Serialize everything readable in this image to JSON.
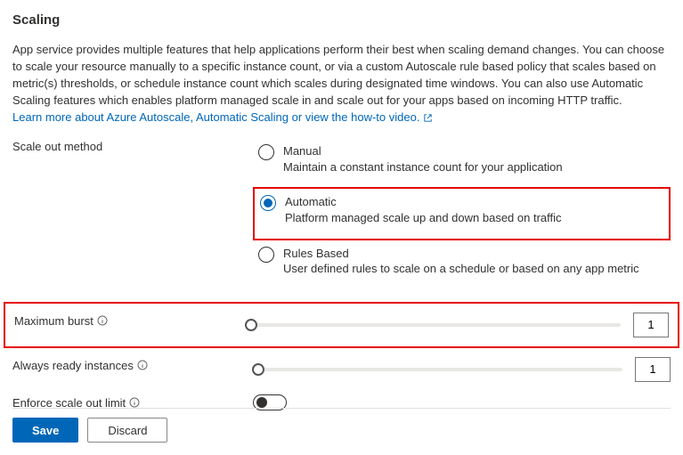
{
  "title": "Scaling",
  "description": "App service provides multiple features that help applications perform their best when scaling demand changes. You can choose to scale your resource manually to a specific instance count, or via a custom Autoscale rule based policy that scales based on metric(s) thresholds, or schedule instance count which scales during designated time windows. You can also use Automatic Scaling features which enables platform managed scale in and scale out for your apps based on incoming HTTP traffic.",
  "learn_more_link": "Learn more about Azure Autoscale, Automatic Scaling or view the how-to video.",
  "labels": {
    "scale_out_method": "Scale out method",
    "maximum_burst": "Maximum burst",
    "always_ready": "Always ready instances",
    "enforce_limit": "Enforce scale out limit"
  },
  "options": {
    "manual": {
      "title": "Manual",
      "desc": "Maintain a constant instance count for your application"
    },
    "automatic": {
      "title": "Automatic",
      "desc": "Platform managed scale up and down based on traffic"
    },
    "rules": {
      "title": "Rules Based",
      "desc": "User defined rules to scale on a schedule or based on any app metric"
    }
  },
  "values": {
    "maximum_burst": "1",
    "always_ready": "1"
  },
  "buttons": {
    "save": "Save",
    "discard": "Discard"
  }
}
